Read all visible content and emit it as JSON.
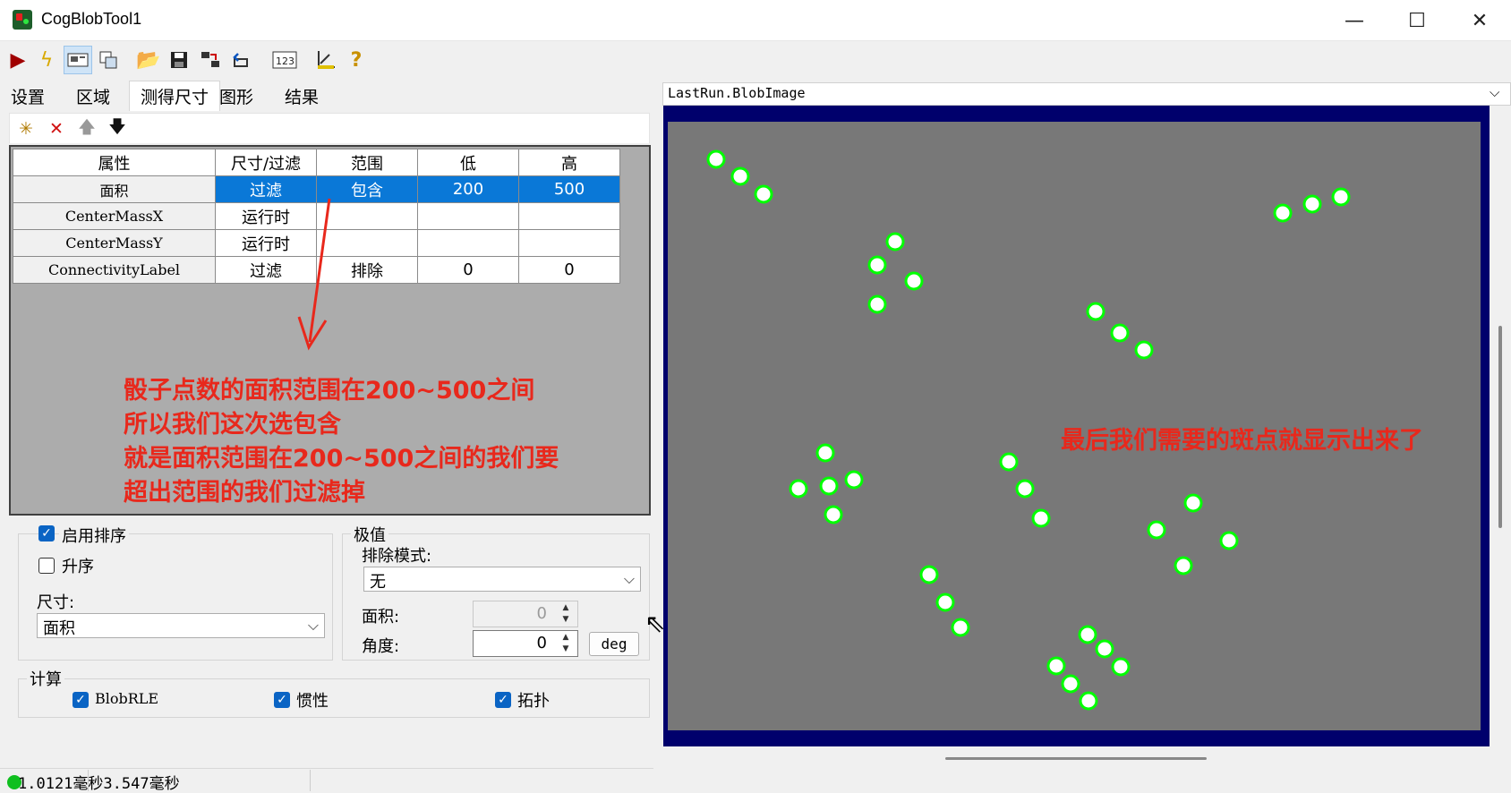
{
  "window": {
    "title": "CogBlobTool1",
    "minimize": "—",
    "maximize": "☐",
    "close": "✕"
  },
  "toolbar": {
    "icons": [
      "run-icon",
      "flash-icon",
      "show-image-icon",
      "copy-icon",
      "open-icon",
      "save-icon",
      "properties-icon",
      "reset-icon",
      "counter-icon",
      "measure-icon",
      "help-icon"
    ]
  },
  "tabs": [
    {
      "label": "设置"
    },
    {
      "label": "区域"
    },
    {
      "label": "测得尺寸"
    },
    {
      "label": "图形"
    },
    {
      "label": "结果"
    }
  ],
  "measure_table": {
    "headers": [
      "属性",
      "尺寸/过滤",
      "范围",
      "低",
      "高"
    ],
    "rows": [
      {
        "prop": "面积",
        "mode": "过滤",
        "range": "包含",
        "low": "200",
        "high": "500"
      },
      {
        "prop": "CenterMassX",
        "mode": "运行时",
        "range": "",
        "low": "",
        "high": ""
      },
      {
        "prop": "CenterMassY",
        "mode": "运行时",
        "range": "",
        "low": "",
        "high": ""
      },
      {
        "prop": "ConnectivityLabel",
        "mode": "过滤",
        "range": "排除",
        "low": "0",
        "high": "0"
      }
    ]
  },
  "annotation_left": [
    "骰子点数的面积范围在200~500之间",
    "所以我们这次选包含",
    "就是面积范围在200~500之间的我们要",
    "超出范围的我们过滤掉"
  ],
  "sort": {
    "enable_label": "启用排序",
    "enable_checked": true,
    "ascending_label": "升序",
    "ascending_checked": false,
    "size_label": "尺寸:",
    "size_value": "面积"
  },
  "extreme": {
    "title": "极值",
    "exclude_mode_label": "排除模式:",
    "exclude_mode_value": "无",
    "area_label": "面积:",
    "area_value": "0",
    "angle_label": "角度:",
    "angle_value": "0",
    "deg_button": "deg"
  },
  "compute": {
    "title": "计算",
    "items": [
      {
        "label": "BlobRLE",
        "checked": true
      },
      {
        "label": "惯性",
        "checked": true
      },
      {
        "label": "拓扑",
        "checked": true
      }
    ]
  },
  "status": {
    "text": "1.0121毫秒3.547毫秒"
  },
  "image_view": {
    "selected_image": "LastRun.BlobImage",
    "annotation": "最后我们需要的斑点就显示出来了"
  },
  "colors": {
    "accent": "#0a78d7",
    "annotation": "#e8281c",
    "blob_outline": "#00ff00",
    "canvas_bg": "#787878",
    "frame": "#00006c"
  }
}
